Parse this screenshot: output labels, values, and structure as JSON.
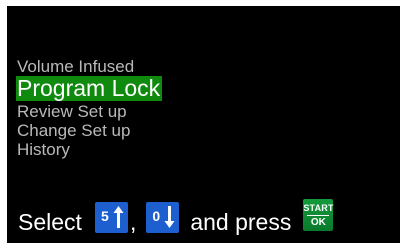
{
  "menu": {
    "items": [
      {
        "label": "Volume Infused"
      },
      {
        "label": "Program Lock",
        "selected": true
      },
      {
        "label": "Review Set up"
      },
      {
        "label": "Change Set up"
      },
      {
        "label": "History"
      }
    ]
  },
  "instruction": {
    "select_text": "Select",
    "comma_text": ",",
    "and_press_text": "and press",
    "up_key": {
      "number": "5",
      "icon": "arrow-up-icon"
    },
    "down_key": {
      "number": "0",
      "icon": "arrow-down-icon"
    },
    "ok_key": {
      "top_label": "START",
      "bottom_label": "OK"
    }
  },
  "colors": {
    "screen_background": "#000000",
    "selected_background": "#0f8a0f",
    "menu_text": "#b9b9b9",
    "key_blue": "#1d5fcf",
    "ok_green": "#0f8a35"
  }
}
